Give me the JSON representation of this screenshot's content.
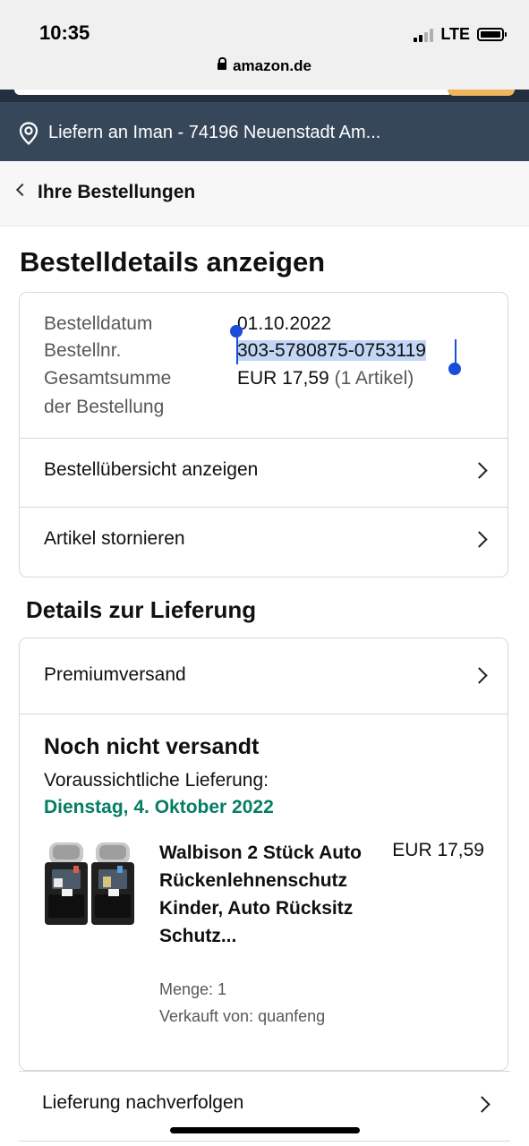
{
  "status_bar": {
    "time": "10:35",
    "network": "LTE",
    "url": "amazon.de"
  },
  "delivery_bar": {
    "text": "Liefern an Iman - 74196 Neuenstadt Am..."
  },
  "nav": {
    "back_label": "Ihre Bestellungen"
  },
  "page": {
    "title": "Bestelldetails anzeigen"
  },
  "order_info": {
    "date_label": "Bestelldatum",
    "date_value": "01.10.2022",
    "number_label": "Bestellnr.",
    "number_value": "303-5780875-0753119",
    "total_label_line1": "Gesamtsumme",
    "total_label_line2": "der Bestellung",
    "total_value": "EUR 17,59",
    "total_items": "(1 Artikel)"
  },
  "order_actions": [
    "Bestellübersicht anzeigen",
    "Artikel stornieren"
  ],
  "delivery_details": {
    "section_title": "Details zur Lieferung",
    "shipping_method": "Premiumversand",
    "shipment_status": "Noch nicht versandt",
    "expected_label": "Voraussichtliche Lieferung:",
    "expected_date": "Dienstag, 4. Oktober 2022",
    "item": {
      "name": "Walbison 2 Stück Auto Rückenlehnenschutz Kinder, Auto Rücksitz Schutz...",
      "price": "EUR 17,59",
      "quantity": "Menge: 1",
      "seller": "Verkauft von: quanfeng"
    }
  },
  "track": {
    "label": "Lieferung nachverfolgen"
  },
  "colors": {
    "header_dark": "#232f3e",
    "deliver_bar": "#37475a",
    "delivery_green": "#067d62",
    "selection": "#c3d6f5",
    "selection_handle": "#1a4ed8"
  }
}
